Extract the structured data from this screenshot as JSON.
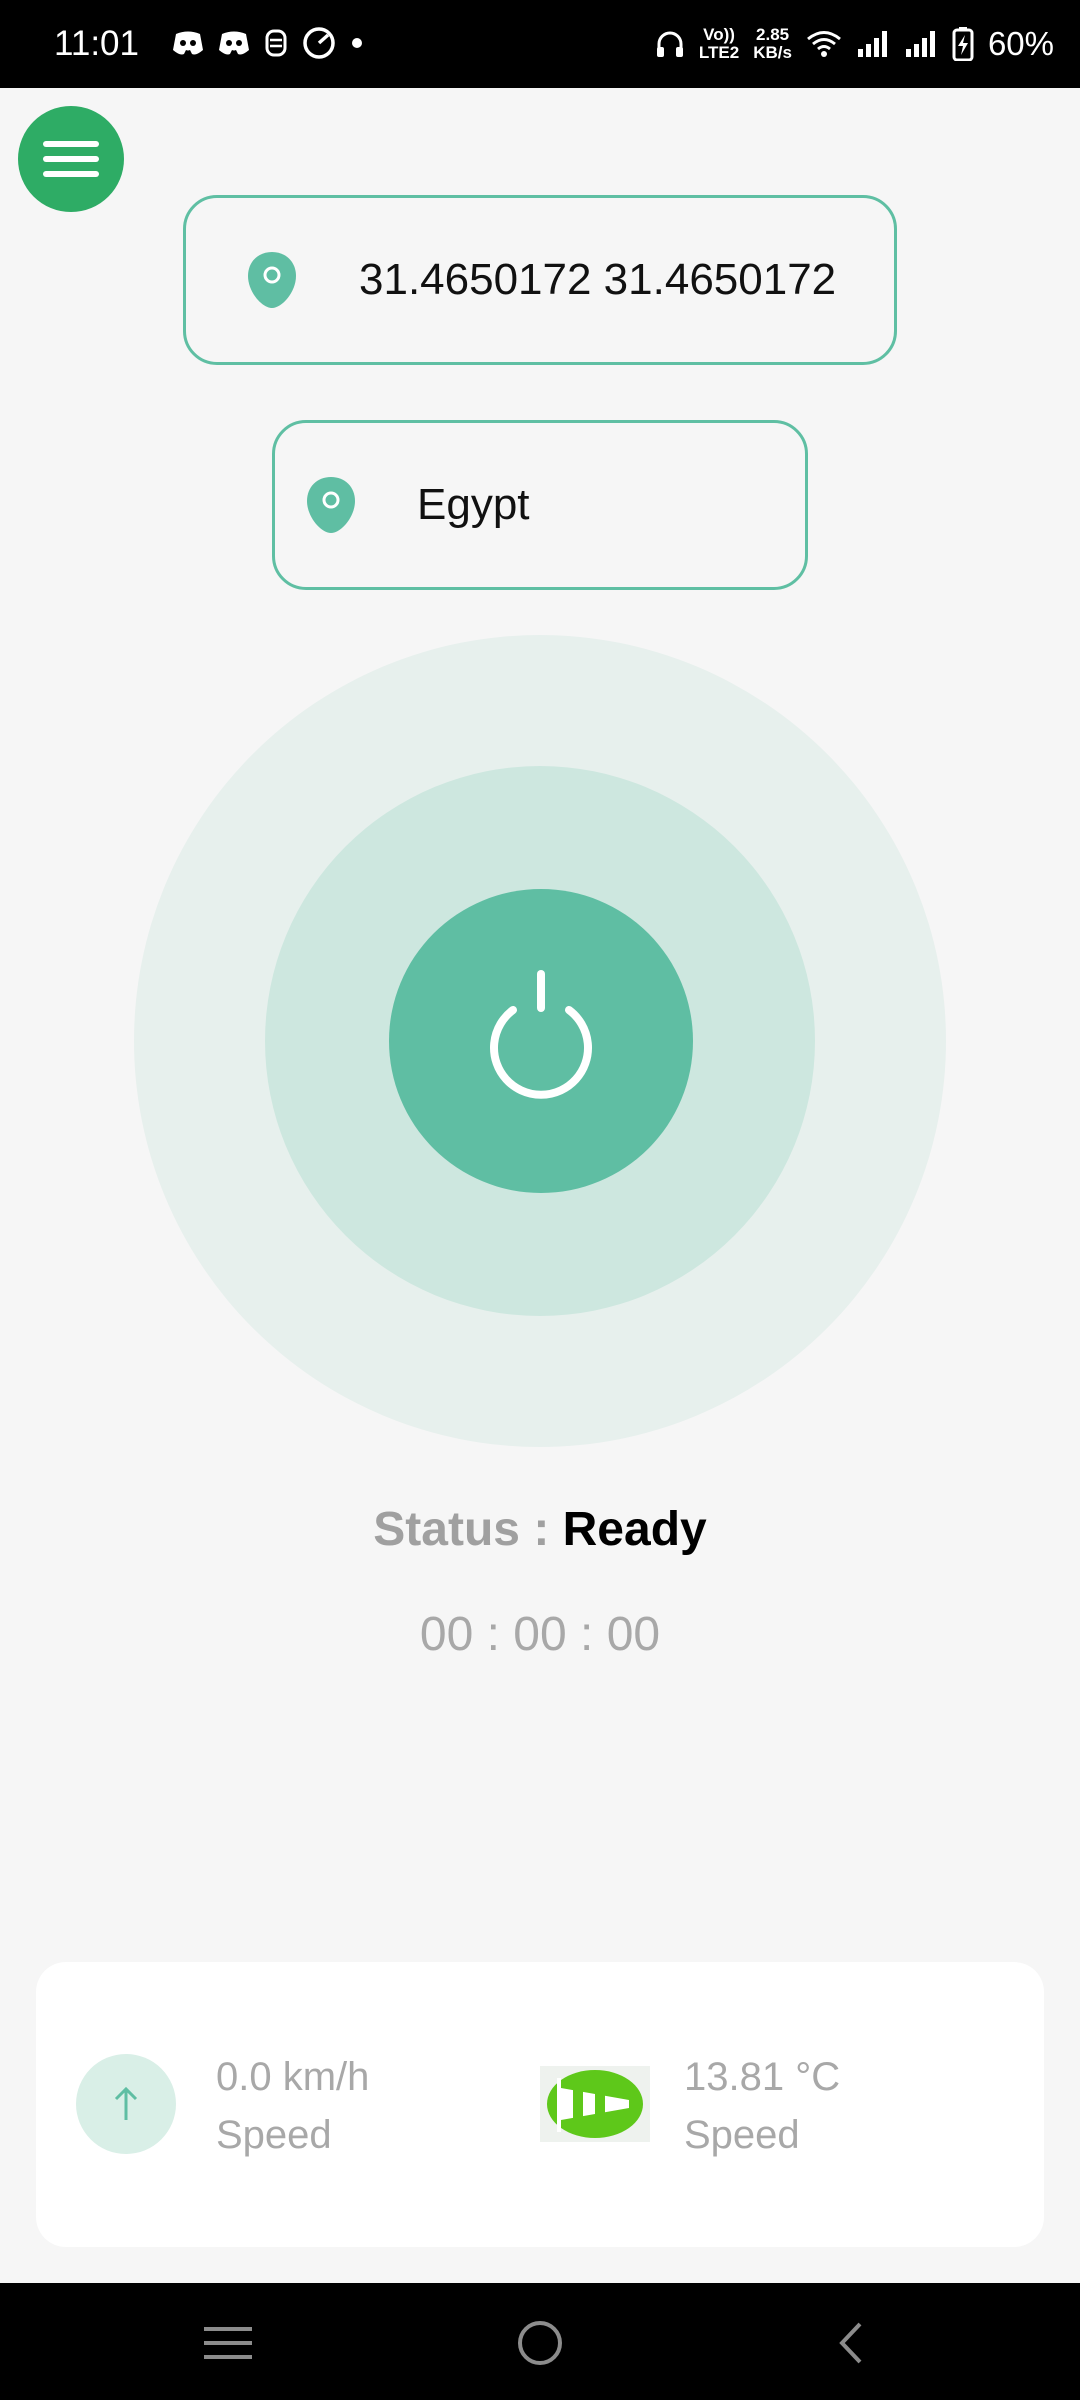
{
  "status_bar": {
    "time": "11:01",
    "volte_top": "Vo))",
    "volte_bottom": "LTE2",
    "net_speed_value": "2.85",
    "net_speed_unit": "KB/s",
    "battery": "60%",
    "left_icons": [
      "discord-icon",
      "discord-icon",
      "jio-icon",
      "speedometer-icon",
      "dot-icon"
    ],
    "right_icons": [
      "headphones-icon",
      "wifi-icon",
      "signal-icon",
      "signal-icon",
      "battery-charging-icon"
    ]
  },
  "location": {
    "coordinates": "31.4650172 31.4650172",
    "country": "Egypt"
  },
  "status": {
    "label": "Status : ",
    "value": "Ready",
    "timer": "00 : 00 : 00"
  },
  "stats": [
    {
      "value": "0.0 km/h",
      "label": "Speed",
      "icon": "arrow-up-icon"
    },
    {
      "value": "13.81 °C",
      "label": "Speed",
      "icon": "windsock-icon"
    }
  ],
  "colors": {
    "accent": "#5fbea3",
    "menu_green": "#2eac65",
    "ring_outer": "#e7f0ed",
    "ring_middle": "#cde7df",
    "text_muted": "#a8a8a8"
  }
}
